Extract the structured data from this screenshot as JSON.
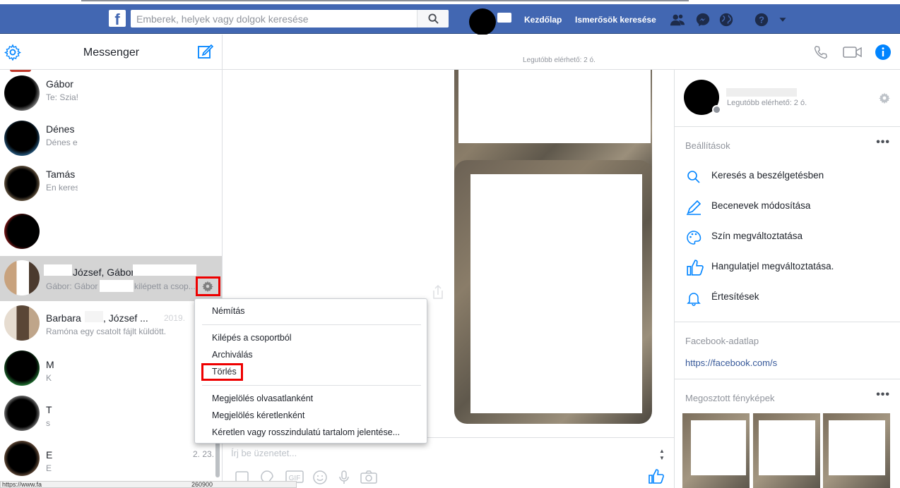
{
  "topbar": {
    "search_placeholder": "Emberek, helyek vagy dolgok keresése",
    "home_label": "Kezdőlap",
    "find_friends_label": "Ismerősök keresése"
  },
  "sidebar": {
    "title": "Messenger",
    "conversations": [
      {
        "name": "Gábor",
        "snippet": "Te: Szia!"
      },
      {
        "name": "Dénes",
        "snippet": "Dénes e"
      },
      {
        "name": "Tamás",
        "snippet": "En keres"
      },
      {
        "name": "",
        "snippet": ""
      },
      {
        "name": "József, Gábor",
        "snippet": "Gábor: Gábor",
        "snippet_end": "kilépett a csop..."
      },
      {
        "name": "Barbara",
        "name_end": ", József ...",
        "date": "2019.",
        "snippet": "Ramóna egy csatolt fájlt küldött."
      },
      {
        "name": "M",
        "snippet": "K"
      },
      {
        "name": "T",
        "snippet": "s"
      },
      {
        "name": "E",
        "snippet": "E",
        "date": "2. 23."
      }
    ]
  },
  "context_menu": {
    "items": [
      "Némítás",
      "Kilépés a csoportból",
      "Archiválás",
      "Törlés",
      "Megjelölés olvasatlanként",
      "Megjelölés kéretlenként",
      "Kéretlen vagy rosszindulatú tartalom jelentése..."
    ]
  },
  "chat": {
    "last_seen": "Legutóbb elérhető: 2 ó.",
    "composer_placeholder": "Írj be üzenetet..."
  },
  "right_panel": {
    "contact_last_seen": "Legutóbb elérhető: 2 ó.",
    "settings_label": "Beállítások",
    "options": [
      {
        "label": "Keresés a beszélgetésben",
        "icon": "search-icon"
      },
      {
        "label": "Becenevek módosítása",
        "icon": "pencil-icon"
      },
      {
        "label": "Szín megváltoztatása",
        "icon": "palette-icon"
      },
      {
        "label": "Hangulatjel megváltoztatása.",
        "icon": "thumbs-up-icon"
      },
      {
        "label": "Értesítések",
        "icon": "bell-icon"
      }
    ],
    "fb_profile_label": "Facebook-adatlap",
    "fb_profile_link": "https://facebook.com/s",
    "shared_photos_label": "Megosztott fényképek"
  },
  "statusbar": {
    "text": "https://www.fa",
    "text_end": "260900"
  },
  "colors": {
    "brand": "#4267b2",
    "accent": "#0084ff",
    "highlight": "#e00000"
  }
}
